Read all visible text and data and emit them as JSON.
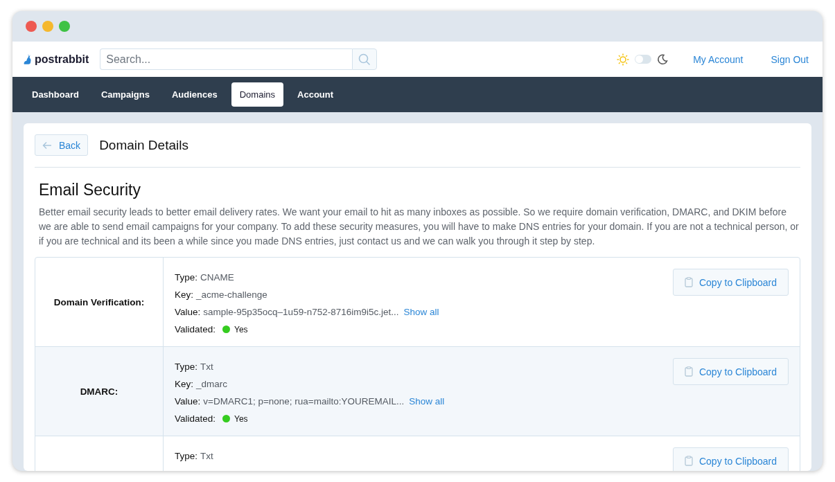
{
  "header": {
    "logo": "postrabbit",
    "search": {
      "placeholder": "Search..."
    },
    "theme_toggle": {
      "on": false
    },
    "links": [
      "My Account",
      "Sign Out"
    ]
  },
  "tabs": [
    {
      "label": "Dashboard",
      "selected": false
    },
    {
      "label": "Campaigns",
      "selected": false
    },
    {
      "label": "Audiences",
      "selected": false
    },
    {
      "label": "Domains",
      "selected": true
    },
    {
      "label": "Account",
      "selected": false
    }
  ],
  "page": {
    "back": "Back",
    "title": "Domain Details",
    "heading": "Email Security",
    "description": "Better email security leads to better email delivery rates. We want your email to hit as many inboxes as possible. So we require domain verification, DMARC, and DKIM before we are able to send email campaigns for your company. To add these security measures, you will have to make DNS entries for your domain. If you are not a technical person, or if you are technical and its been a while since you made DNS entries, just contact us and we can walk you through it step by step."
  },
  "records": [
    {
      "label": "Domain Verification:",
      "button": "Copy to Clipboard",
      "lines": [
        {
          "kind": "text",
          "label": "Type:",
          "value": "CNAME"
        },
        {
          "kind": "text",
          "label": "Key:",
          "value": "_acme-challenge"
        },
        {
          "kind": "link",
          "label": "Value:",
          "value": "sample-95p35ocq–1u59-n752-8716im9i5c.jet...",
          "link": "Show all"
        },
        {
          "kind": "status",
          "label": "Validated:",
          "value": "Yes",
          "color": "#35cc1f"
        }
      ]
    },
    {
      "label": "DMARC:",
      "button": "Copy to Clipboard",
      "lines": [
        {
          "kind": "text",
          "label": "Type:",
          "value": "Txt"
        },
        {
          "kind": "text",
          "label": "Key:",
          "value": "_dmarc"
        },
        {
          "kind": "link",
          "label": "Value:",
          "value": "v=DMARC1; p=none; rua=mailto:YOUREMAIL...",
          "link": "Show all"
        },
        {
          "kind": "status",
          "label": "Validated:",
          "value": "Yes",
          "color": "#35cc1f"
        }
      ]
    },
    {
      "button": "Copy to Clipboard",
      "lines": [
        {
          "kind": "text",
          "label": "Type:",
          "value": "Txt"
        }
      ]
    }
  ]
}
